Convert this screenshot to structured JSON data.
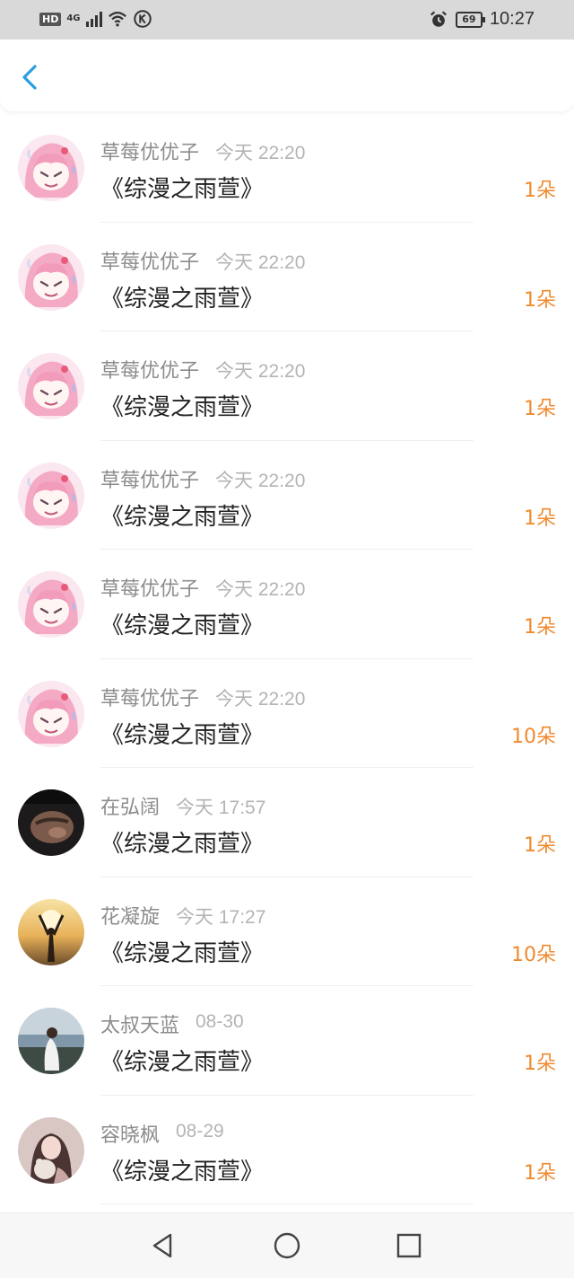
{
  "status_bar": {
    "hd": "HD",
    "network": "4G",
    "battery": "69",
    "time": "10:27"
  },
  "nav": {
    "back_icon": "chevron-left-icon"
  },
  "records": [
    {
      "name": "草莓优优子",
      "time": "今天 22:20",
      "title": "《综漫之雨萱》",
      "amount": "1朵",
      "avatar": "anime-pink"
    },
    {
      "name": "草莓优优子",
      "time": "今天 22:20",
      "title": "《综漫之雨萱》",
      "amount": "1朵",
      "avatar": "anime-pink"
    },
    {
      "name": "草莓优优子",
      "time": "今天 22:20",
      "title": "《综漫之雨萱》",
      "amount": "1朵",
      "avatar": "anime-pink"
    },
    {
      "name": "草莓优优子",
      "time": "今天 22:20",
      "title": "《综漫之雨萱》",
      "amount": "1朵",
      "avatar": "anime-pink"
    },
    {
      "name": "草莓优优子",
      "time": "今天 22:20",
      "title": "《综漫之雨萱》",
      "amount": "1朵",
      "avatar": "anime-pink"
    },
    {
      "name": "草莓优优子",
      "time": "今天 22:20",
      "title": "《综漫之雨萱》",
      "amount": "10朵",
      "avatar": "anime-pink"
    },
    {
      "name": "在弘阔",
      "time": "今天 17:57",
      "title": "《综漫之雨萱》",
      "amount": "1朵",
      "avatar": "dark-photo"
    },
    {
      "name": "花凝旋",
      "time": "今天 17:27",
      "title": "《综漫之雨萱》",
      "amount": "10朵",
      "avatar": "sunset-photo"
    },
    {
      "name": "太叔天蓝",
      "time": "08-30",
      "title": "《综漫之雨萱》",
      "amount": "1朵",
      "avatar": "lake-photo"
    },
    {
      "name": "容晓枫",
      "time": "08-29",
      "title": "《综漫之雨萱》",
      "amount": "1朵",
      "avatar": "girl-photo"
    }
  ],
  "colors": {
    "accent_orange": "#f08a2f",
    "back_blue": "#2a9fe0",
    "name_gray": "#8c8c8c",
    "time_gray": "#b4b4b4"
  },
  "bottom_nav": [
    "back-triangle-icon",
    "home-circle-icon",
    "recents-square-icon"
  ]
}
